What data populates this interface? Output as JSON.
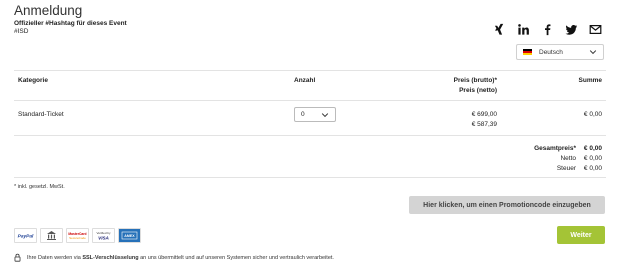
{
  "header": {
    "title": "Anmeldung",
    "hashtag_label": "Offizieller #Hashtag für dieses Event",
    "hashtag_value": "#ISD"
  },
  "social": {
    "icons": [
      "xing-icon",
      "linkedin-icon",
      "facebook-icon",
      "twitter-icon",
      "mail-icon"
    ]
  },
  "language": {
    "selected": "Deutsch",
    "flag_colors": [
      "#000000",
      "#dd0000",
      "#ffce00"
    ]
  },
  "table": {
    "headers": {
      "category": "Kategorie",
      "quantity": "Anzahl",
      "price_gross": "Preis (brutto)*",
      "price_net": "Preis (netto)",
      "sum": "Summe"
    },
    "rows": [
      {
        "category": "Standard-Ticket",
        "quantity": "0",
        "price_gross": "€ 699,00",
        "price_net": "€ 587,39",
        "sum": "€ 0,00"
      }
    ]
  },
  "totals": {
    "total_label": "Gesamtpreis*",
    "total_value": "€ 0,00",
    "net_label": "Netto",
    "net_value": "€ 0,00",
    "tax_label": "Steuer",
    "tax_value": "€ 0,00"
  },
  "footnote": "* inkl. gesetzl. MwSt.",
  "promo_button": "Hier klicken, um einen Promotioncode einzugeben",
  "payments": {
    "paypal": "PayPal",
    "visa": "VISA",
    "verified_by": "Verified by",
    "mastercard": "MasterCard",
    "mastercard_sub": "SecureCode",
    "amex": "AMEX"
  },
  "next_button": "Weiter",
  "ssl_notice": {
    "prefix": "Ihre Daten werden via ",
    "highlight": "SSL-Verschlüsselung",
    "suffix": " an uns übermittelt und auf unseren Systemen sicher und vertraulich verarbeitet."
  },
  "colors": {
    "accent_green": "#a4c436",
    "promo_gray": "#d4d4d4"
  }
}
